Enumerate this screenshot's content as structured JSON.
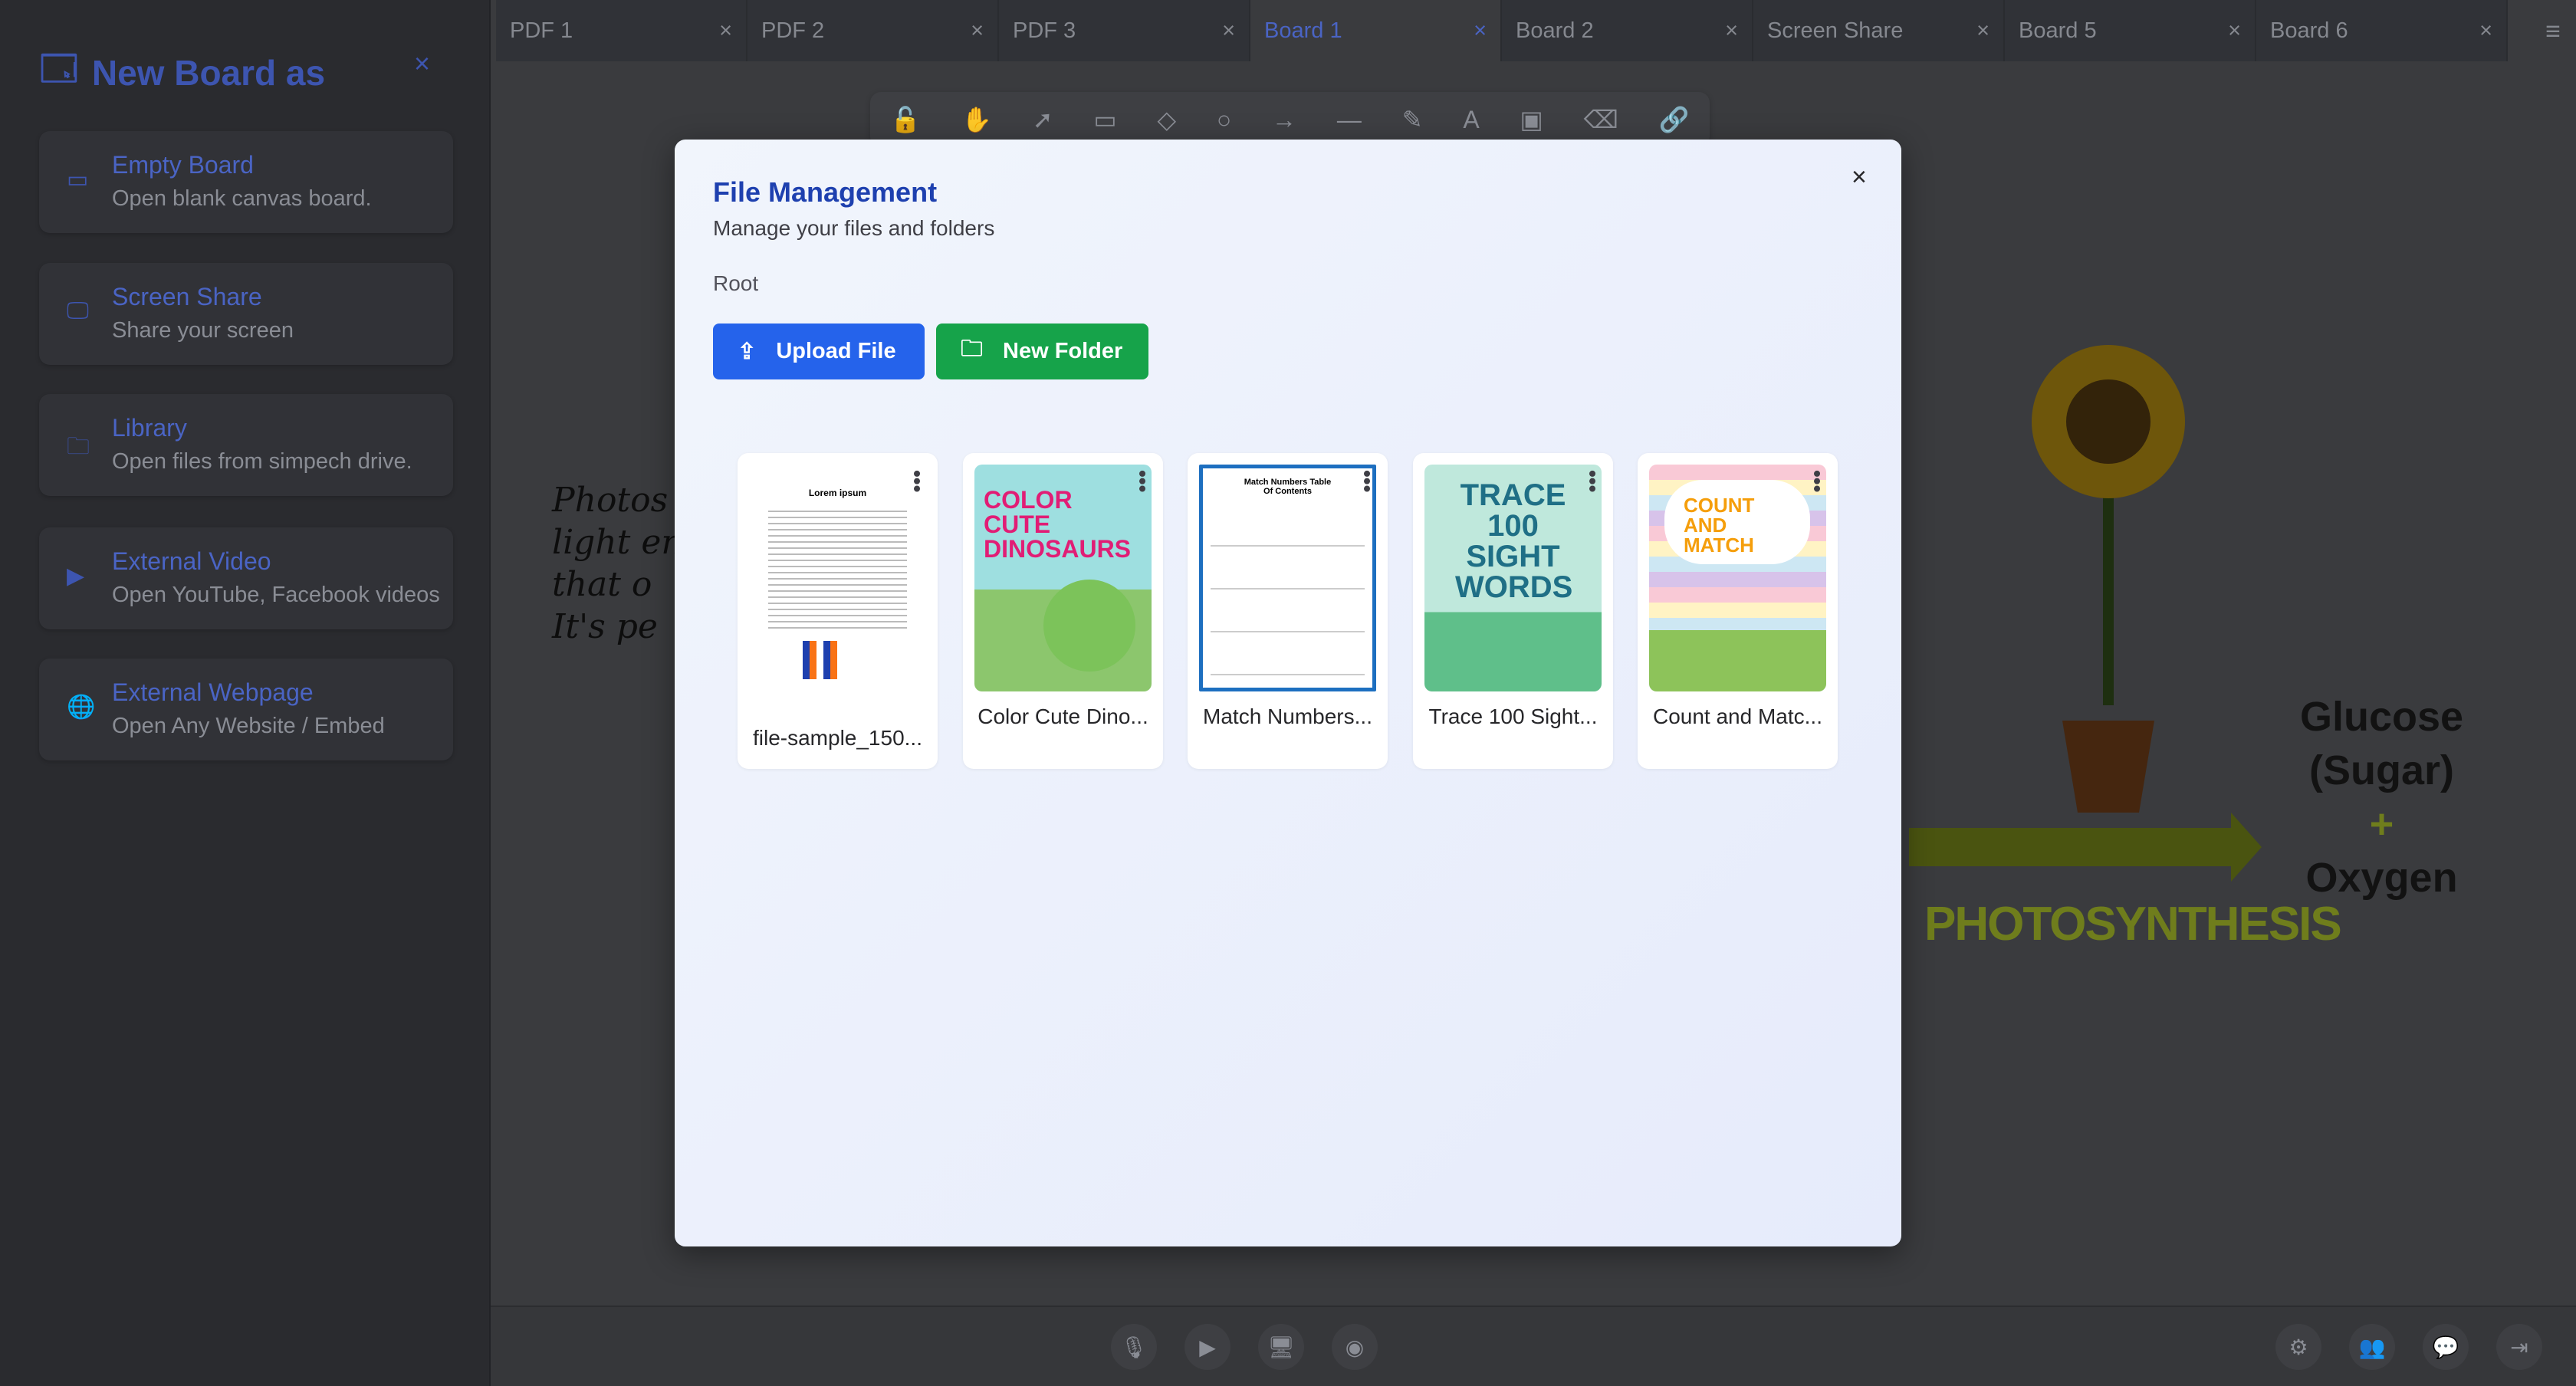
{
  "sidebar": {
    "title": "New Board as",
    "icon": "board-icon",
    "close": "×",
    "items": [
      {
        "title": "Empty Board",
        "desc": "Open blank canvas board.",
        "icon": "presentation-icon"
      },
      {
        "title": "Screen Share",
        "desc": "Share your screen",
        "icon": "monitor-share-icon"
      },
      {
        "title": "Library",
        "desc": "Open files from simpech drive.",
        "icon": "folder-icon"
      },
      {
        "title": "External Video",
        "desc": "Open YouTube, Facebook videos",
        "icon": "video-icon"
      },
      {
        "title": "External Webpage",
        "desc": "Open Any Website / Embed",
        "icon": "globe-icon"
      }
    ]
  },
  "tabs": [
    {
      "label": "PDF 1"
    },
    {
      "label": "PDF 2"
    },
    {
      "label": "PDF 3"
    },
    {
      "label": "Board 1",
      "active": true
    },
    {
      "label": "Board 2"
    },
    {
      "label": "Screen Share"
    },
    {
      "label": "Board 5"
    },
    {
      "label": "Board 6"
    }
  ],
  "tab_close": "×",
  "menu_icon": "≡",
  "toolbar": [
    {
      "icon": "lock-icon",
      "glyph": "🔓"
    },
    {
      "icon": "hand-icon",
      "glyph": "✋"
    },
    {
      "icon": "pointer-icon",
      "glyph": "➚"
    },
    {
      "icon": "rectangle-icon",
      "glyph": "▭"
    },
    {
      "icon": "diamond-icon",
      "glyph": "◇"
    },
    {
      "icon": "circle-icon",
      "glyph": "○"
    },
    {
      "icon": "arrow-icon",
      "glyph": "→"
    },
    {
      "icon": "line-icon",
      "glyph": "—"
    },
    {
      "icon": "pencil-icon",
      "glyph": "✎"
    },
    {
      "icon": "text-icon",
      "glyph": "A"
    },
    {
      "icon": "image-icon",
      "glyph": "▣"
    },
    {
      "icon": "eraser-icon",
      "glyph": "⌫"
    },
    {
      "icon": "link-icon",
      "glyph": "🔗"
    }
  ],
  "canvas": {
    "handwriting": [
      "Photos",
      "light en",
      "that o",
      "It's pe"
    ],
    "glucose": "Glucose",
    "sugar": "(Sugar)",
    "plus": "+",
    "oxygen": "Oxygen",
    "photosynthesis": "PHOTOSYNTHESIS"
  },
  "bottombar": {
    "left": [
      {
        "icon": "mic-icon",
        "glyph": "🎙"
      },
      {
        "icon": "camera-icon",
        "glyph": "▶"
      },
      {
        "icon": "screen-share-icon",
        "glyph": "🖥"
      },
      {
        "icon": "record-icon",
        "glyph": "◉"
      }
    ],
    "right": [
      {
        "icon": "settings-icon",
        "glyph": "⚙"
      },
      {
        "icon": "participants-icon",
        "glyph": "👥"
      },
      {
        "icon": "chat-icon",
        "glyph": "💬"
      },
      {
        "icon": "leave-icon",
        "glyph": "⇥"
      }
    ]
  },
  "modal": {
    "title": "File Management",
    "subtitle": "Manage your files and folders",
    "breadcrumb": "Root",
    "close": "×",
    "upload_label": "Upload File",
    "new_folder_label": "New Folder",
    "upload_color": "#2563eb",
    "folder_color": "#16a34a",
    "files": [
      {
        "name": "file-sample_150...",
        "cover": "Lorem ipsum"
      },
      {
        "name": "Color Cute Dino...",
        "cover": "COLOR CUTE DINOSAURS"
      },
      {
        "name": "Match Numbers...",
        "cover": "Match Numbers Table Of Contents"
      },
      {
        "name": "Trace 100 Sight...",
        "cover": "TRACE 100 SIGHT WORDS"
      },
      {
        "name": "Count and Matc...",
        "cover": "COUNT AND MATCH"
      }
    ]
  }
}
